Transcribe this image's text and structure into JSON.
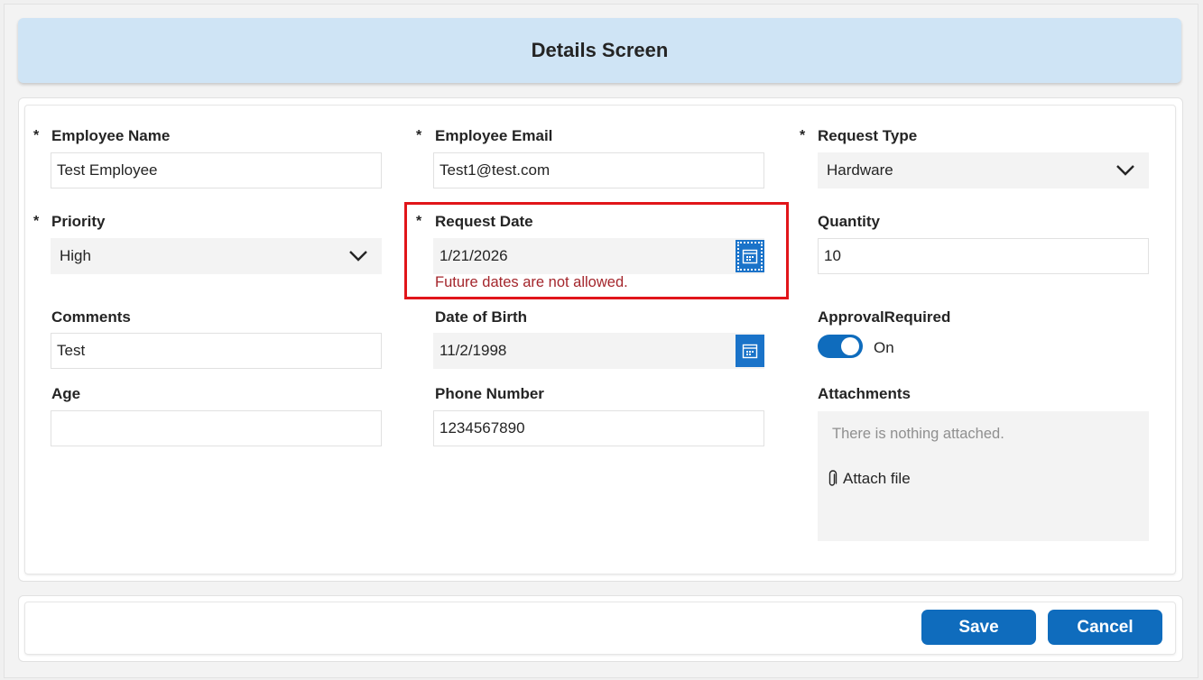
{
  "header": {
    "title": "Details Screen"
  },
  "fields": {
    "employee_name": {
      "label": "Employee Name",
      "required": "*",
      "value": "Test Employee"
    },
    "employee_email": {
      "label": "Employee Email",
      "required": "*",
      "value": "Test1@test.com"
    },
    "request_type": {
      "label": "Request Type",
      "required": "*",
      "value": "Hardware"
    },
    "priority": {
      "label": "Priority",
      "required": "*",
      "value": "High"
    },
    "request_date": {
      "label": "Request Date",
      "required": "*",
      "value": "1/21/2026",
      "error": "Future dates are not allowed."
    },
    "quantity": {
      "label": "Quantity",
      "value": "10"
    },
    "comments": {
      "label": "Comments",
      "value": "Test"
    },
    "date_of_birth": {
      "label": "Date of Birth",
      "value": "11/2/1998"
    },
    "approval_required": {
      "label": "ApprovalRequired",
      "state": "On"
    },
    "age": {
      "label": "Age",
      "value": ""
    },
    "phone_number": {
      "label": "Phone Number",
      "value": "1234567890"
    },
    "attachments": {
      "label": "Attachments",
      "empty_text": "There is nothing attached.",
      "link": "Attach file"
    }
  },
  "buttons": {
    "save": "Save",
    "cancel": "Cancel"
  },
  "icons": {
    "calendar": "calendar-icon",
    "chevron": "chevron-down-icon",
    "paperclip": "paperclip-icon"
  },
  "colors": {
    "accent": "#0f6cbd",
    "error": "#a4262c",
    "highlight": "#e1151a",
    "header_bg": "#cfe4f5"
  }
}
